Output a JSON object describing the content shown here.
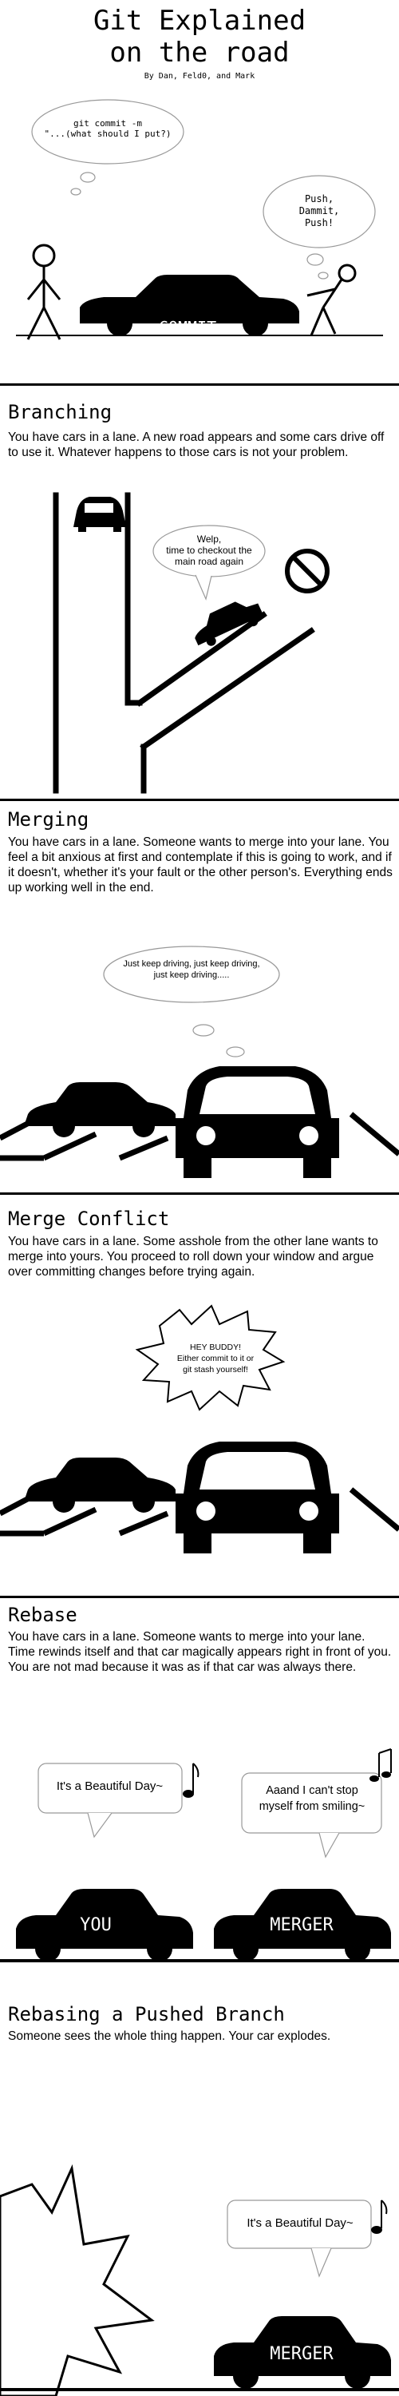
{
  "header": {
    "title": "Git Explained\non the road",
    "byline": "By Dan, Feld0, and Mark"
  },
  "panel1": {
    "thought_left": "git commit -m\n\"...(what should I put?)",
    "thought_right": "Push,\nDammit,\nPush!",
    "car_label": "COMMIT"
  },
  "sections": [
    {
      "title": "Branching",
      "text": "You have cars in a lane. A new road appears and some cars drive off to use it. Whatever happens to those cars is not your problem.",
      "bubble": "Welp,\ntime to checkout the\nmain road again"
    },
    {
      "title": "Merging",
      "text": "You have cars in a lane. Someone wants to merge into your lane. You feel a bit anxious at first and contemplate if this is going to work, and if it doesn't, whether it's your fault or the other person's. Everything ends up working well in the end.",
      "bubble": "Just keep driving, just keep driving,\njust keep driving....."
    },
    {
      "title": "Merge Conflict",
      "text": "You have cars in a lane. Some asshole from the other lane wants to merge into yours. You proceed to roll down your window and argue over committing changes before trying again.",
      "bubble": "HEY BUDDY!\nEither commit to it or\ngit stash yourself!"
    },
    {
      "title": "Rebase",
      "text": "You have cars in a lane. Someone wants to merge into your lane. Time rewinds itself and that car magically appears right in front of you. You are not mad because it was as if that car was always there.",
      "bubble_left": "It's a Beautiful Day~",
      "bubble_right": "Aaand I can't stop\nmyself from smiling~",
      "car_left": "YOU",
      "car_right": "MERGER"
    },
    {
      "title": "Rebasing a Pushed Branch",
      "text": "Someone sees the whole thing happen. Your car explodes.",
      "bubble": "It's a Beautiful Day~",
      "car": "MERGER"
    }
  ],
  "colors": {
    "ink": "#000000",
    "paper": "#ffffff",
    "cloud_stroke": "#999999"
  }
}
